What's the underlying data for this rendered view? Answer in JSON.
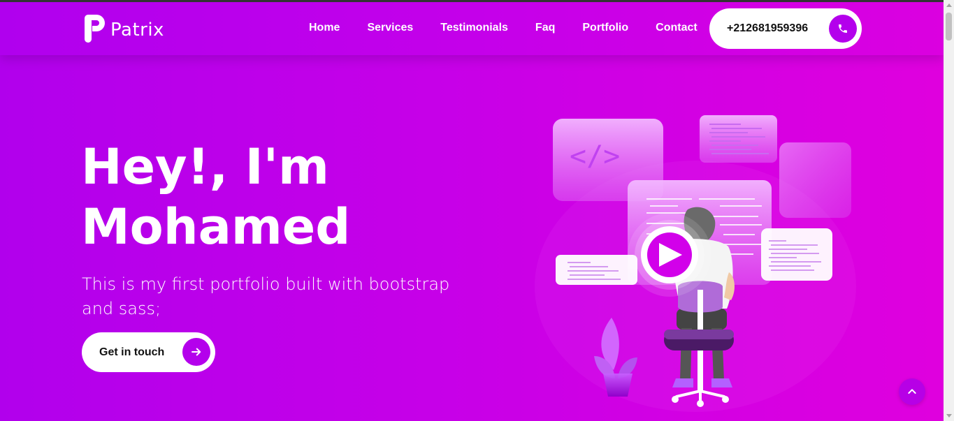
{
  "brand": {
    "name": "Patrix",
    "logo_icon": "patrix-p-logo"
  },
  "nav": {
    "items": [
      {
        "label": "Home"
      },
      {
        "label": "Services"
      },
      {
        "label": "Testimonials"
      },
      {
        "label": "Faq"
      },
      {
        "label": "Portfolio"
      },
      {
        "label": "Contact"
      }
    ]
  },
  "phone": {
    "number": "+212681959396",
    "icon": "phone-icon"
  },
  "hero": {
    "title_line1": "Hey!, I'm",
    "title_line2": "Mohamed",
    "subtitle": "This is my first portfolio built with bootstrap and sass;",
    "cta_label": "Get in touch",
    "cta_icon": "arrow-right-icon",
    "illustration_code_symbol": "</>"
  },
  "back_to_top": {
    "icon": "chevron-up-icon"
  },
  "colors": {
    "accent": "#b400ec",
    "gradient_start": "#b100ec",
    "gradient_end": "#e000de"
  }
}
